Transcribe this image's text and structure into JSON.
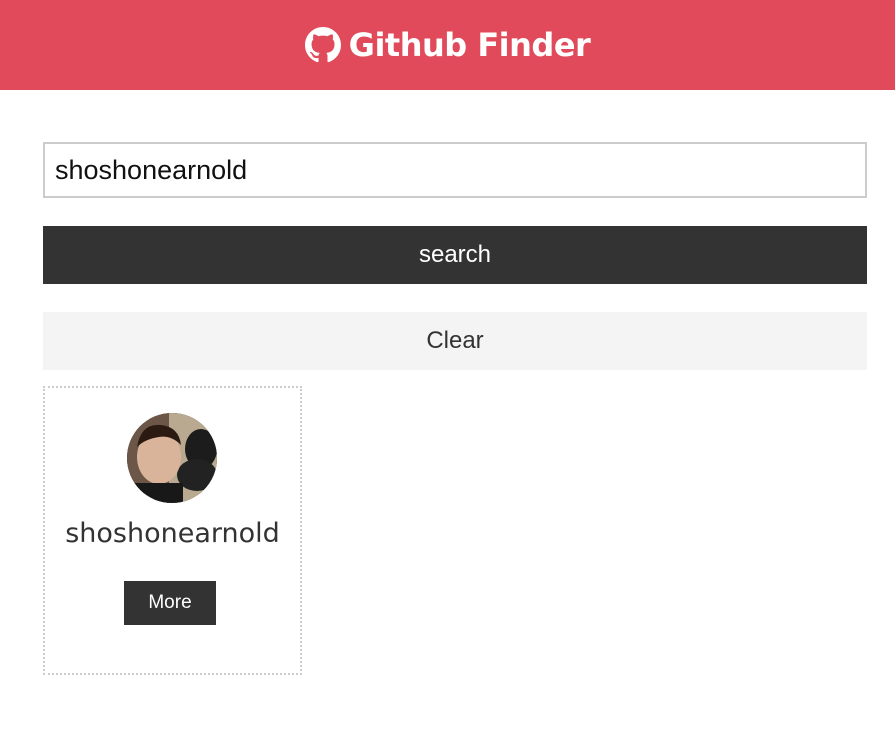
{
  "app": {
    "title": "Github Finder",
    "brand_icon": "github-icon",
    "accent_color": "#e04a5a"
  },
  "search": {
    "value": "shoshonearnold",
    "submit_label": "search",
    "clear_label": "Clear"
  },
  "results": [
    {
      "login": "shoshonearnold",
      "avatar": "user-avatar-photo",
      "more_label": "More"
    }
  ]
}
